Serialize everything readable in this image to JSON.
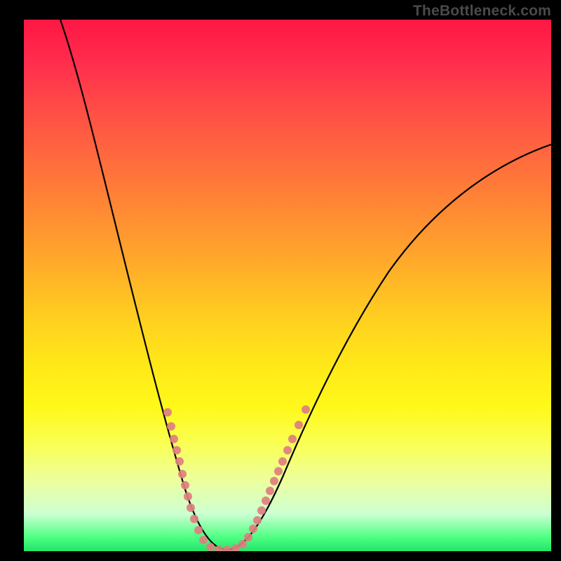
{
  "attribution": "TheBottleneck.com",
  "colors": {
    "frame": "#000000",
    "curve": "#000000",
    "dots": "#e08080",
    "gradient_top": "#ff1744",
    "gradient_bottom": "#22e36b"
  },
  "chart_data": {
    "type": "line",
    "title": "",
    "xlabel": "",
    "ylabel": "",
    "xlim": [
      0,
      100
    ],
    "ylim": [
      0,
      100
    ],
    "grid": false,
    "legend": false,
    "series": [
      {
        "name": "curve",
        "x": [
          7,
          10,
          13,
          16,
          19,
          22,
          25,
          27,
          29,
          31,
          33,
          35,
          37,
          40,
          45,
          50,
          55,
          60,
          65,
          70,
          75,
          80,
          85,
          90,
          95,
          100
        ],
        "y": [
          100,
          92,
          83,
          74,
          65,
          56,
          47,
          40,
          33,
          26,
          19,
          12,
          7,
          2,
          3,
          9,
          17,
          26,
          34,
          42,
          49,
          56,
          62,
          67,
          72,
          76
        ]
      }
    ],
    "annotations": {
      "dot_cluster_x_range": [
        27,
        45
      ],
      "dot_cluster_y_range": [
        0,
        28
      ],
      "dot_count_approx": 30
    }
  }
}
